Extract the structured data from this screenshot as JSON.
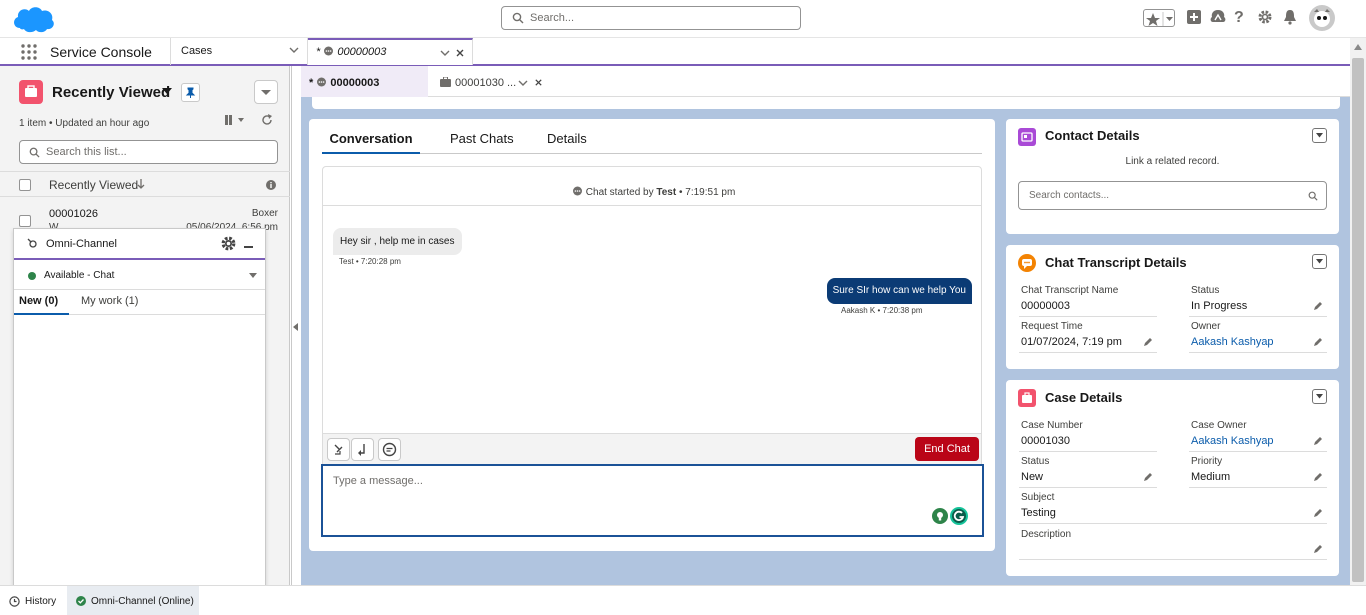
{
  "header": {
    "search_placeholder": "Search..."
  },
  "nav": {
    "app_name": "Service Console",
    "object_tab": "Cases",
    "workspace_tab": "00000003",
    "workspace_tab_prefix": "*"
  },
  "subtabs": {
    "tab1": "00000003",
    "tab1_prefix": "*",
    "tab2": "00001030 ..."
  },
  "list_view": {
    "title": "Recently Viewed",
    "meta": "1 item • Updated an hour ago",
    "search_placeholder": "Search this list...",
    "column_header": "Recently Viewed",
    "row": {
      "number": "00001026",
      "sub": "W...",
      "owner": "Boxer",
      "date": "05/06/2024, 6:56 pm"
    }
  },
  "omni": {
    "title": "Omni-Channel",
    "status": "Available - Chat",
    "tab_new": "New (0)",
    "tab_mywork": "My work (1)"
  },
  "chat": {
    "tabs": [
      "Conversation",
      "Past Chats",
      "Details"
    ],
    "started_prefix": "Chat started by",
    "started_by": "Test",
    "started_time": "• 7:19:51 pm",
    "msg_in": "Hey sir , help me in cases",
    "msg_in_meta": "Test • 7:20:28 pm",
    "msg_out": "Sure SIr how can we help You",
    "msg_out_meta": "Aakash K • 7:20:38 pm",
    "end_chat": "End Chat",
    "input_placeholder": "Type a message..."
  },
  "contact_card": {
    "title": "Contact Details",
    "link_text": "Link a related record.",
    "search_placeholder": "Search contacts..."
  },
  "transcript_card": {
    "title": "Chat Transcript Details",
    "name_label": "Chat Transcript Name",
    "name_value": "00000003",
    "status_label": "Status",
    "status_value": "In Progress",
    "request_label": "Request Time",
    "request_value": "01/07/2024, 7:19 pm",
    "owner_label": "Owner",
    "owner_value": "Aakash Kashyap"
  },
  "case_card": {
    "title": "Case Details",
    "number_label": "Case Number",
    "number_value": "00001030",
    "owner_label": "Case Owner",
    "owner_value": "Aakash Kashyap",
    "status_label": "Status",
    "status_value": "New",
    "priority_label": "Priority",
    "priority_value": "Medium",
    "subject_label": "Subject",
    "subject_value": "Testing",
    "description_label": "Description",
    "description_value": ""
  },
  "footer": {
    "history": "History",
    "omni": "Omni-Channel (Online)"
  },
  "colors": {
    "brand_blue": "#1b96ff",
    "accent_purple": "#7a5cb8",
    "end_chat_red": "#ba0517",
    "agent_bubble": "#0b3b75",
    "workspace_bg": "#b0c4df",
    "link_blue": "#0b5cab",
    "online_green": "#2e844a"
  }
}
